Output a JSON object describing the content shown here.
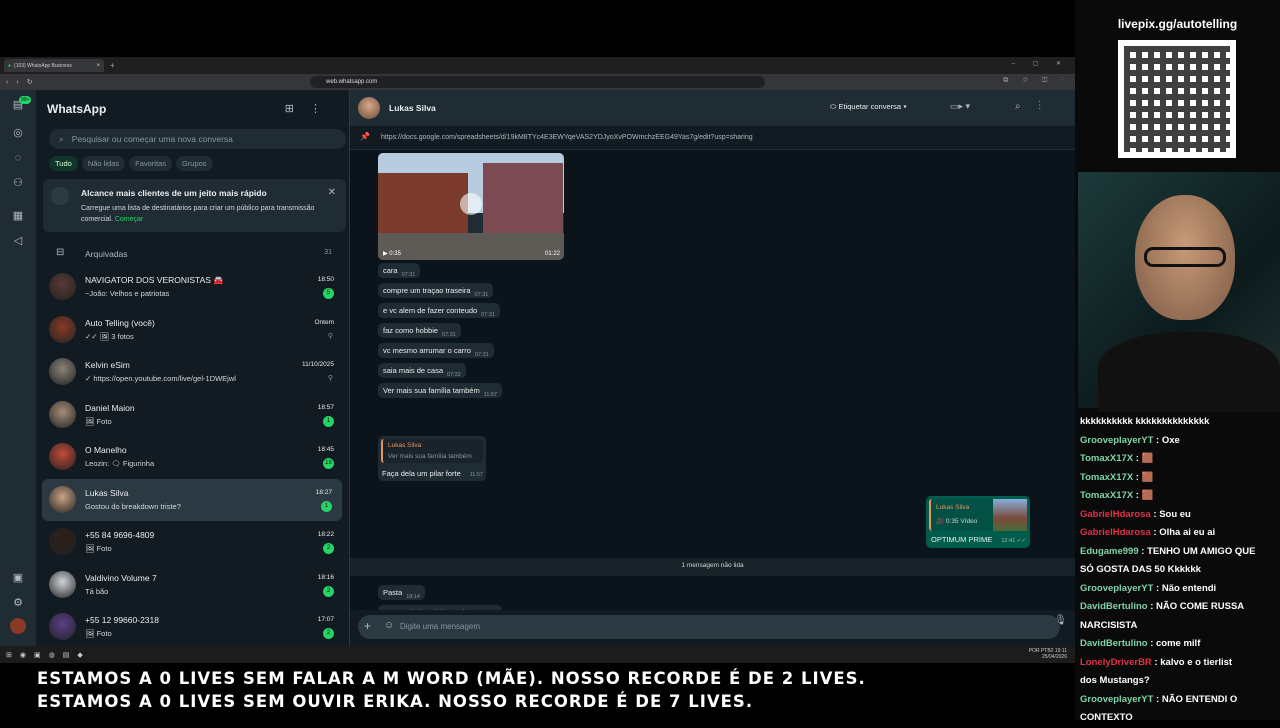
{
  "browser": {
    "tab_title": "(103) WhatsApp Business",
    "url": "web.whatsapp.com"
  },
  "nav": {
    "badge": "99+"
  },
  "sidebar": {
    "title": "WhatsApp",
    "search_placeholder": "Pesquisar ou começar uma nova conversa",
    "filters": [
      "Tudo",
      "Não lidas",
      "Favoritas",
      "Grupos"
    ],
    "promo": {
      "title": "Alcance mais clientes de um jeito mais rápido",
      "text": "Carregue uma lista de destinatários para criar um público para transmissão comercial.",
      "link": "Começar"
    },
    "archived": {
      "label": "Arquivadas",
      "count": "31"
    },
    "chats": [
      {
        "name": "NAVIGATOR DOS VERONISTAS 🚘",
        "preview": "~João: Velhos e patriotas",
        "time": "18:50",
        "badge": "5",
        "avatar": "#5a3a34"
      },
      {
        "name": "Auto Telling (você)",
        "preview": "✓✓ 🖼 3 fotos",
        "time": "Ontem",
        "badge": "",
        "avatar": "#8a3b28"
      },
      {
        "name": "Kelvin eSim",
        "preview": "✓ https://open.youtube.com/live/gel-1DWEjwl",
        "time": "11/10/2025",
        "badge": "",
        "avatar": "#8b8378"
      },
      {
        "name": "Daniel Maion",
        "preview": "🖼 Foto",
        "time": "18:57",
        "badge": "1",
        "avatar": "#a58e7a"
      },
      {
        "name": "O Manelho",
        "preview": "Leozin: 🗨 Figurinha",
        "time": "18:45",
        "badge": "18",
        "avatar": "#c44a3a"
      },
      {
        "name": "Lukas Silva",
        "preview": "Gostou do breakdown triste?",
        "time": "18:27",
        "badge": "1",
        "avatar": "#caa384"
      },
      {
        "name": "+55 84 9696-4809",
        "preview": "🖼 Foto",
        "time": "18:22",
        "badge": "2",
        "avatar": "#2b2018"
      },
      {
        "name": "Valdivino Volume 7",
        "preview": "Tá bão",
        "time": "18:16",
        "badge": "2",
        "avatar": "#d0d4da"
      },
      {
        "name": "+55 12 99660-2318",
        "preview": "🖼 Foto",
        "time": "17:07",
        "badge": "2",
        "avatar": "#5a3f8a"
      }
    ]
  },
  "conversation": {
    "contact": "Lukas Silva",
    "tag_label": "Etiquetar conversa",
    "pinned_link": "https://docs.google.com/spreadsheets/d/19kM8TYc4E3EWYqeVAS2YDJyoXvPOWmchzEEG49Yas7g/edit?usp=sharing",
    "video": {
      "duration": "0:35",
      "time": "01:22"
    },
    "messages": [
      {
        "text": "cara",
        "time": "07:31"
      },
      {
        "text": "compre um traçao traseira",
        "time": "07:31"
      },
      {
        "text": "e vc alem de fazer conteudo",
        "time": "07:31"
      },
      {
        "text": "faz como hobbie",
        "time": "07:31"
      },
      {
        "text": "vc mesmo arrumar o carro",
        "time": "07:31"
      },
      {
        "text": "saia mais de casa",
        "time": "07:32"
      },
      {
        "text": "Ver mais sua família também",
        "time": "11:57"
      }
    ],
    "quote": {
      "name": "Lukas Silva",
      "text": "Ver mais sua família também",
      "reply": "Faça dela um pilar forte",
      "time": "11:57"
    },
    "outgoing": {
      "qname": "Lukas Silva",
      "qtext": "🎥 0:35 Vídeo",
      "text": "OPTIMUM PRIME",
      "time": "12:41"
    },
    "unread_label": "1 mensagem não lida",
    "late": [
      {
        "text": "Pasta",
        "time": "18:14"
      },
      {
        "text": "Gostou do breakdown triste?",
        "time": "18:27"
      }
    ],
    "composer_placeholder": "Digite uma mensagem"
  },
  "tray": {
    "lang": "POR PTB2",
    "clock": "19:11",
    "date": "25/04/2026"
  },
  "stream": {
    "url": "livepix.gg/autotelling",
    "chat": [
      {
        "user": "",
        "msg": "kkkkkkkkkk kkkkkkkkkkkkkk",
        "color": "#ffffff"
      },
      {
        "user": "GrooveplayerYT",
        "msg": ": Oxe",
        "color": "#7fd4a8"
      },
      {
        "user": "TomaxX17X",
        "msg": ": 🟫",
        "color": "#7fd4a8"
      },
      {
        "user": "TomaxX17X",
        "msg": ": 🟫",
        "color": "#7fd4a8"
      },
      {
        "user": "TomaxX17X",
        "msg": ": 🟫",
        "color": "#7fd4a8"
      },
      {
        "user": "GabrielHdarosa",
        "msg": ": Sou eu",
        "color": "#e0304a"
      },
      {
        "user": "GabrielHdarosa",
        "msg": ": Olha ai eu ai",
        "color": "#e0304a"
      },
      {
        "user": "Edugame999",
        "msg": ": TENHO UM AMIGO QUE",
        "color": "#7fd4a8"
      },
      {
        "user": "",
        "msg": "SÓ GOSTA DAS 50 Kkkkkk",
        "color": "#ffffff"
      },
      {
        "user": "GrooveplayerYT",
        "msg": ": Não entendi",
        "color": "#7fd4a8"
      },
      {
        "user": "DavidBertulino",
        "msg": ": NÃO COME RUSSA",
        "color": "#7fd4a8"
      },
      {
        "user": "",
        "msg": "NARCISISTA",
        "color": "#ffffff"
      },
      {
        "user": "DavidBertulino",
        "msg": ": come milf",
        "color": "#7fd4a8"
      },
      {
        "user": "LonelyDriverBR",
        "msg": ": kalvo e o tierlist",
        "color": "#e0304a"
      },
      {
        "user": "",
        "msg": "dos Mustangs?",
        "color": "#ffffff"
      },
      {
        "user": "GrooveplayerYT",
        "msg": ": NÃO ENTENDI O",
        "color": "#7fd4a8"
      },
      {
        "user": "",
        "msg": "CONTEXTO",
        "color": "#ffffff"
      }
    ]
  },
  "overlay": {
    "line1": "ESTAMOS A 0 LIVES SEM FALAR A M WORD (MÃE). NOSSO RECORDE É DE 2 LIVES.",
    "line2": "ESTAMOS A 0 LIVES SEM OUVIR ERIKA. NOSSO RECORDE É DE 7 LIVES."
  }
}
